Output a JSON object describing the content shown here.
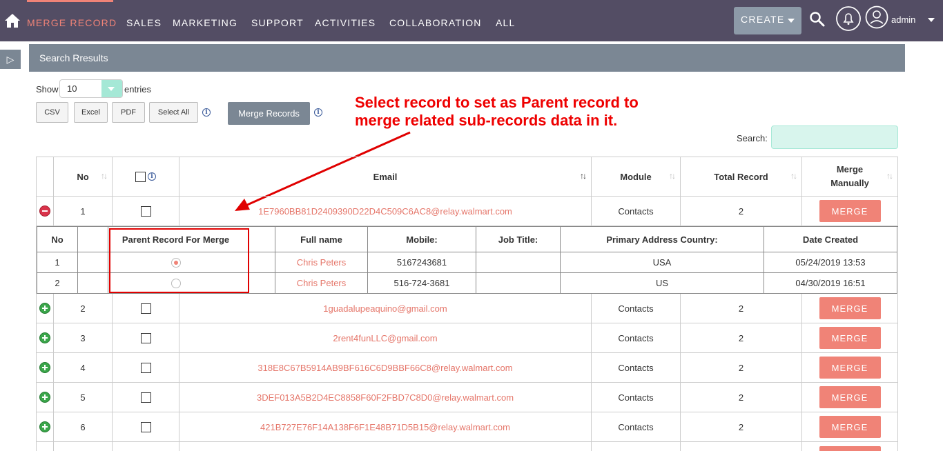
{
  "nav": {
    "items": [
      "MERGE RECORD",
      "SALES",
      "MARKETING",
      "SUPPORT",
      "ACTIVITIES",
      "COLLABORATION",
      "ALL"
    ],
    "create_label": "CREATE",
    "user_label": "admin"
  },
  "panel": {
    "title": "Search Rresults"
  },
  "controls": {
    "show_label": "Show",
    "entries_label": "entries",
    "page_size": "10",
    "buttons": [
      "CSV",
      "Excel",
      "PDF",
      "Select All"
    ],
    "merge_records_label": "Merge Records",
    "search_label": "Search:"
  },
  "annotation": {
    "line1": "Select record to set as Parent record to",
    "line2": "merge related sub-records data in it."
  },
  "table": {
    "headers": [
      "No",
      "Email",
      "Module",
      "Total Record",
      "Merge Manually"
    ],
    "merge_button_label": "MERGE",
    "rows": [
      {
        "no": "1",
        "email": "1E7960BB81D2409390D22D4C509C6AC8@relay.walmart.com",
        "module": "Contacts",
        "total": "2",
        "expanded": true
      },
      {
        "no": "2",
        "email": "1guadalupeaquino@gmail.com",
        "module": "Contacts",
        "total": "2",
        "expanded": false
      },
      {
        "no": "3",
        "email": "2rent4funLLC@gmail.com",
        "module": "Contacts",
        "total": "2",
        "expanded": false
      },
      {
        "no": "4",
        "email": "318E8C67B5914AB9BF616C6D9BBF66C8@relay.walmart.com",
        "module": "Contacts",
        "total": "2",
        "expanded": false
      },
      {
        "no": "5",
        "email": "3DEF013A5B2D4EC8858F60F2FBD7C8D0@relay.walmart.com",
        "module": "Contacts",
        "total": "2",
        "expanded": false
      },
      {
        "no": "6",
        "email": "421B727E76F14A138F6F1E48B71D5B15@relay.walmart.com",
        "module": "Contacts",
        "total": "2",
        "expanded": false
      }
    ]
  },
  "subtable": {
    "headers": [
      "No",
      "Parent Record For Merge",
      "Full name",
      "Mobile:",
      "Job Title:",
      "Primary Address Country:",
      "Date Created"
    ],
    "rows": [
      {
        "no": "1",
        "selected": true,
        "name": "Chris Peters",
        "mobile": "5167243681",
        "job": "",
        "country": "USA",
        "date": "05/24/2019 13:53"
      },
      {
        "no": "2",
        "selected": false,
        "name": "Chris Peters",
        "mobile": "516-724-3681",
        "job": "",
        "country": "US",
        "date": "04/30/2019 16:51"
      }
    ]
  }
}
